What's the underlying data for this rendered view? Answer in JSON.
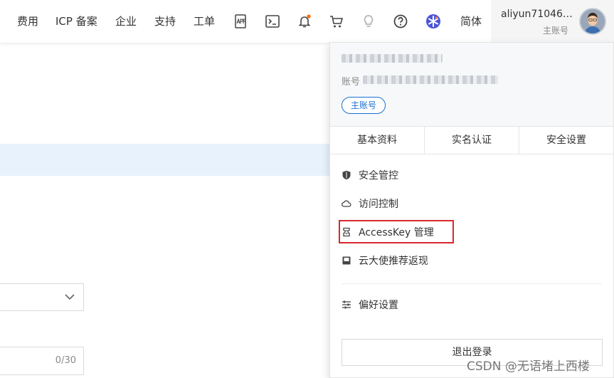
{
  "topnav": {
    "items": [
      "费用",
      "ICP 备案",
      "企业",
      "支持",
      "工单"
    ],
    "lang": "简体",
    "icons": [
      "app-icon",
      "terminal-icon",
      "bell-icon",
      "cart-icon",
      "lightbulb-icon",
      "help-icon",
      "service-logo-icon"
    ]
  },
  "account": {
    "name": "aliyun71046…",
    "role": "主账号"
  },
  "panel": {
    "account_label": "账号",
    "badge": "主账号",
    "tabs": [
      "基本资料",
      "实名认证",
      "安全设置"
    ],
    "menu": [
      {
        "label": "安全管控",
        "icon": "shield-icon"
      },
      {
        "label": "访问控制",
        "icon": "cloud-icon"
      },
      {
        "label": "AccessKey 管理",
        "icon": "key-icon"
      },
      {
        "label": "云大使推荐返现",
        "icon": "card-icon"
      },
      {
        "label": "偏好设置",
        "icon": "sliders-icon"
      }
    ],
    "logout": "退出登录"
  },
  "background": {
    "input_counter": "0/30"
  },
  "colors": {
    "accent": "#1a6fd3",
    "highlight_border": "#d9272e",
    "notification_dot": "#ff6a00",
    "banner": "#e7f2fc"
  },
  "watermark": "CSDN @无语堵上西楼"
}
